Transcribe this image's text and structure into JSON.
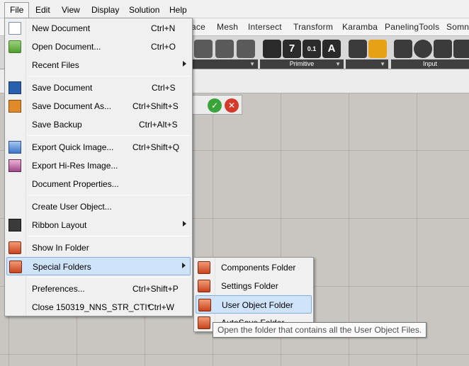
{
  "menubar": {
    "items": [
      "File",
      "Edit",
      "View",
      "Display",
      "Solution",
      "Help"
    ]
  },
  "ribbon_tabs": [
    "ace",
    "Mesh",
    "Intersect",
    "Transform",
    "Karamba",
    "PanelingTools",
    "Somni"
  ],
  "ribbon_groups": {
    "primitive_label": "Primitive",
    "input_label": "Input",
    "primitive_icons": [
      "7",
      "0.1",
      "A"
    ]
  },
  "file_menu": {
    "items": [
      {
        "label": "New Document",
        "shortcut": "Ctrl+N",
        "icon": "new-document-icon"
      },
      {
        "label": "Open Document...",
        "shortcut": "Ctrl+O",
        "icon": "open-folder-icon"
      },
      {
        "label": "Recent Files",
        "shortcut": "",
        "icon": "",
        "submenu": true
      },
      {
        "label": "Save Document",
        "shortcut": "Ctrl+S",
        "icon": "save-icon"
      },
      {
        "label": "Save Document As...",
        "shortcut": "Ctrl+Shift+S",
        "icon": "save-as-icon"
      },
      {
        "label": "Save Backup",
        "shortcut": "Ctrl+Alt+S",
        "icon": ""
      },
      {
        "label": "Export Quick Image...",
        "shortcut": "Ctrl+Shift+Q",
        "icon": "export-image-icon"
      },
      {
        "label": "Export Hi-Res Image...",
        "shortcut": "",
        "icon": "export-hires-icon"
      },
      {
        "label": "Document Properties...",
        "shortcut": "",
        "icon": ""
      },
      {
        "label": "Create User Object...",
        "shortcut": "",
        "icon": ""
      },
      {
        "label": "Ribbon Layout",
        "shortcut": "",
        "icon": "ribbon-layout-icon",
        "submenu": true
      },
      {
        "label": "Show In Folder",
        "shortcut": "",
        "icon": "folder-icon"
      },
      {
        "label": "Special Folders",
        "shortcut": "",
        "icon": "folder-icon",
        "submenu": true,
        "highlighted": true
      },
      {
        "label": "Preferences...",
        "shortcut": "Ctrl+Shift+P",
        "icon": ""
      },
      {
        "label": "Close 150319_NNS_STR_CTI*",
        "shortcut": "Ctrl+W",
        "icon": ""
      }
    ]
  },
  "special_folders_menu": {
    "items": [
      {
        "label": "Components Folder",
        "icon": "folder-icon"
      },
      {
        "label": "Settings Folder",
        "icon": "folder-icon"
      },
      {
        "label": "User Object Folder",
        "icon": "folder-icon",
        "highlighted": true
      },
      {
        "label": "AutoSave Folder",
        "icon": "folder-icon"
      }
    ]
  },
  "tooltip": {
    "text": "Open the folder that contains all the User Object Files."
  },
  "colors": {
    "highlight": "#cfe4fa",
    "highlight_border": "#84acdd",
    "canvas": "#c9c6c1"
  }
}
